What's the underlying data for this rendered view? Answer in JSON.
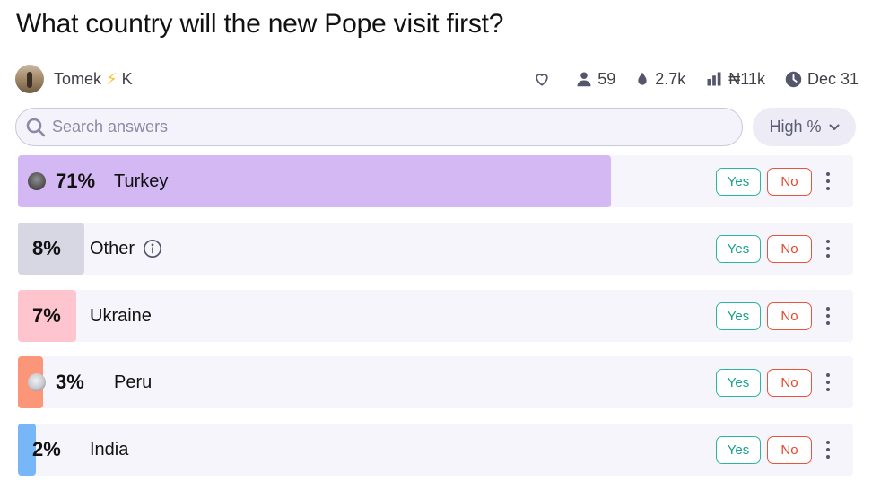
{
  "question": {
    "title": "What country will the new Pope visit first?"
  },
  "creator": {
    "name": "Tomek",
    "suffix": "K",
    "bolt_icon": "lightning-bolt-icon"
  },
  "stats": {
    "traders": "59",
    "volume": "2.7k",
    "liquidity": "₦11k",
    "close_date": "Dec 31"
  },
  "search": {
    "placeholder": "Search answers",
    "value": ""
  },
  "sort": {
    "label": "High %"
  },
  "buttons": {
    "yes": "Yes",
    "no": "No"
  },
  "colors": {
    "turkey": "#d4b8f3",
    "other": "#d6d7e3",
    "ukraine": "#fec5cf",
    "peru": "#fb9679",
    "india": "#77b6f7"
  },
  "answers": [
    {
      "label": "Turkey",
      "percent": "71%",
      "probability": 0.71,
      "color": "#d4b8f3",
      "has_avatar": true,
      "has_info": false
    },
    {
      "label": "Other",
      "percent": "8%",
      "probability": 0.08,
      "color": "#d6d7e3",
      "has_avatar": false,
      "has_info": true
    },
    {
      "label": "Ukraine",
      "percent": "7%",
      "probability": 0.07,
      "color": "#fec5cf",
      "has_avatar": false,
      "has_info": false
    },
    {
      "label": "Peru",
      "percent": "3%",
      "probability": 0.03,
      "color": "#fb9679",
      "has_avatar": true,
      "has_info": false
    },
    {
      "label": "India",
      "percent": "2%",
      "probability": 0.02,
      "color": "#77b6f7",
      "has_avatar": false,
      "has_info": false
    }
  ]
}
